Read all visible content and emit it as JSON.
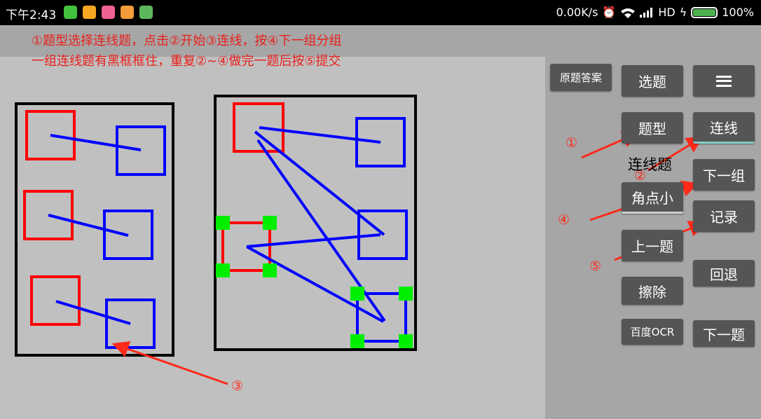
{
  "status_bar": {
    "time": "下午2:43",
    "network_speed": "0.00K/s",
    "network_type": "HD",
    "battery": "100%",
    "app_icons": [
      {
        "name": "app-green-icon",
        "color": "#43c23d"
      },
      {
        "name": "app-orange-icon",
        "color": "#f5a623"
      },
      {
        "name": "app-pink-icon",
        "color": "#f06292"
      },
      {
        "name": "app-orange2-icon",
        "color": "#f39c39"
      },
      {
        "name": "app-green2-icon",
        "color": "#5cb85c"
      }
    ]
  },
  "instructions": {
    "line1": "①题型选择连线题，点击②开始③连线，按④下一组分组",
    "line2": "一组连线题有黑框框住，重复②~④做完一题后按⑤提交"
  },
  "panel": {
    "original_answer": "原题答案",
    "select_question": "选题",
    "question_type": "题型",
    "connect": "连线",
    "mode_label": "连线题",
    "next_group": "下一组",
    "corner_small": "角点小",
    "record": "记录",
    "previous_question": "上一题",
    "undo": "回退",
    "erase": "擦除",
    "baidu_ocr": "百度OCR",
    "next_question": "下一题"
  },
  "annotations": {
    "marker_1": "①",
    "marker_2": "②",
    "marker_3": "③",
    "marker_4": "④",
    "marker_5": "⑤"
  },
  "colors": {
    "annotation_red": "#ff2a1a",
    "left_box_red": "#ff0000",
    "right_box_blue": "#0000ff",
    "corner_green": "#00ee00",
    "button_gray": "#555555",
    "accent_teal": "#80cbc4"
  }
}
